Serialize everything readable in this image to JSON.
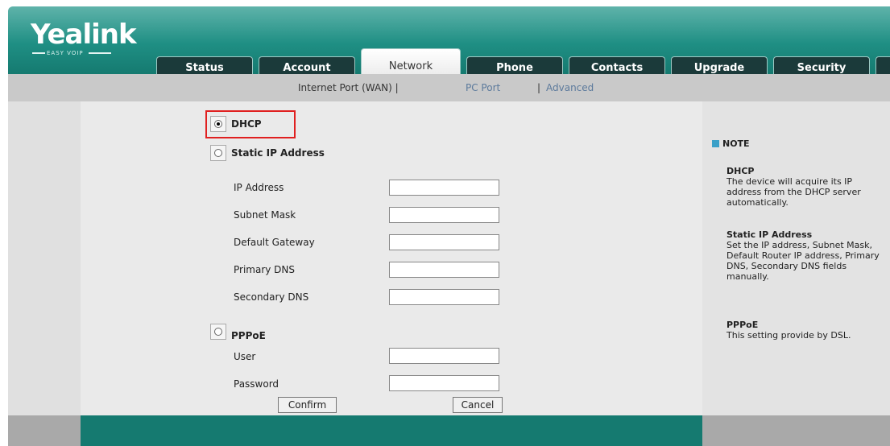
{
  "app": {
    "logo": "Yealink",
    "logo_sub": "EASY VOIP"
  },
  "tabs": [
    {
      "label": "Status"
    },
    {
      "label": "Account"
    },
    {
      "label": "Network",
      "active": true
    },
    {
      "label": "Phone"
    },
    {
      "label": "Contacts"
    },
    {
      "label": "Upgrade"
    },
    {
      "label": "Security"
    }
  ],
  "subnav": {
    "wan": "Internet Port (WAN) |",
    "pc": "PC Port",
    "sep": "|",
    "advanced": "Advanced"
  },
  "form": {
    "dhcp_label": "DHCP",
    "static_label": "Static IP Address",
    "pppoe_label": "PPPoE",
    "selected": "DHCP",
    "static_fields": [
      {
        "label": "IP Address",
        "value": ""
      },
      {
        "label": "Subnet Mask",
        "value": ""
      },
      {
        "label": "Default Gateway",
        "value": ""
      },
      {
        "label": "Primary DNS",
        "value": ""
      },
      {
        "label": "Secondary DNS",
        "value": ""
      }
    ],
    "pppoe_fields": [
      {
        "label": "User",
        "value": ""
      },
      {
        "label": "Password",
        "value": ""
      }
    ],
    "confirm": "Confirm",
    "cancel": "Cancel"
  },
  "note": {
    "title": "NOTE",
    "items": [
      {
        "heading": "DHCP",
        "text": "The device will acquire its IP address from the DHCP server automatically."
      },
      {
        "heading": "Static IP Address",
        "text": "Set the IP address, Subnet Mask, Default Router IP address, Primary DNS, Secondary DNS fields manually."
      },
      {
        "heading": "PPPoE",
        "text": "This setting provide by DSL."
      }
    ]
  },
  "colors": {
    "brand": "#1f8f84",
    "tab_dark": "#1b3a3a",
    "highlight": "#e02020"
  }
}
